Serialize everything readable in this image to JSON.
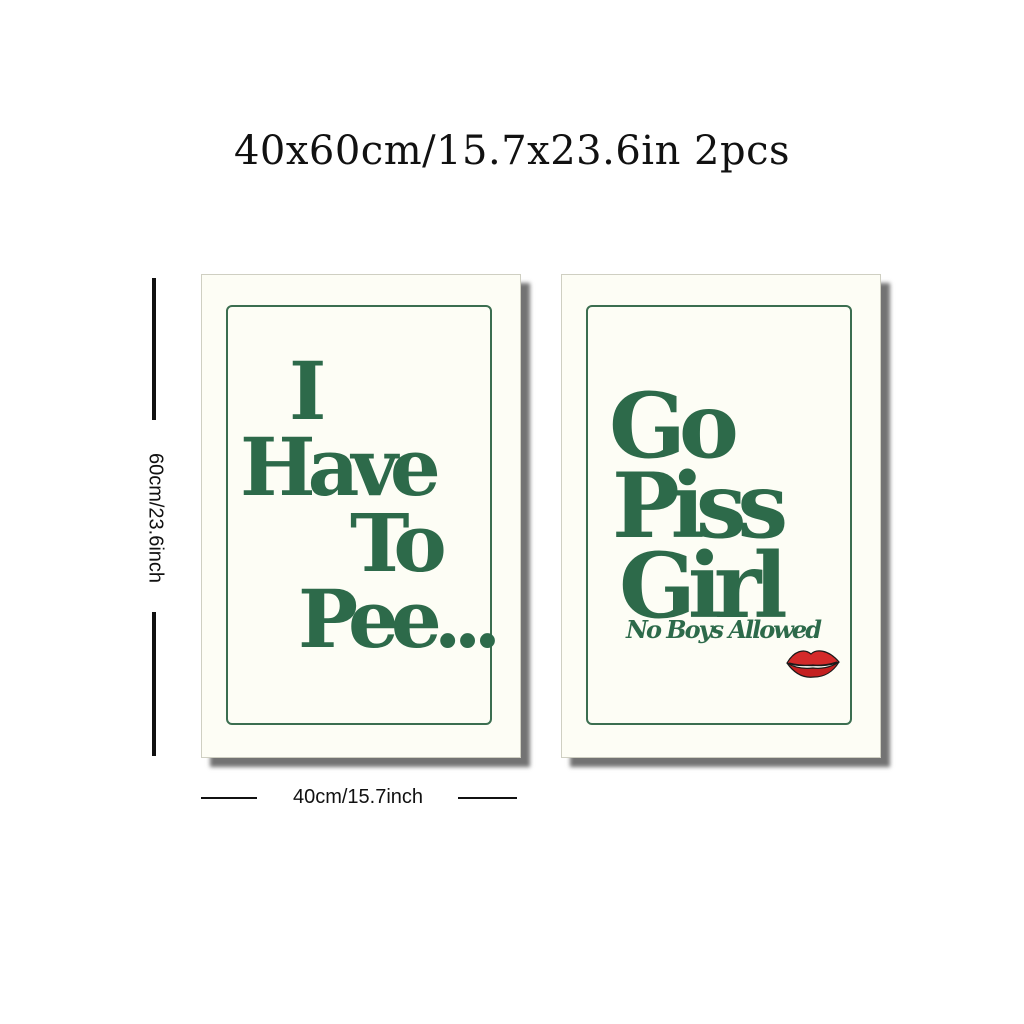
{
  "title": "40x60cm/15.7x23.6in 2pcs",
  "height_label": "60cm/23.6inch",
  "width_label": "40cm/15.7inch",
  "colors": {
    "text_green": "#2d6a4a",
    "frame_green": "#3b6e50",
    "poster_bg": "#fdfdf5",
    "lips_red": "#d42a2a"
  },
  "poster_left": {
    "lines": [
      "I",
      "Have",
      "To",
      "Pee..."
    ]
  },
  "poster_right": {
    "lines": [
      "Go",
      "Piss",
      "Girl"
    ],
    "subtitle": "No Boys Allowed",
    "decoration": "lips-icon"
  }
}
